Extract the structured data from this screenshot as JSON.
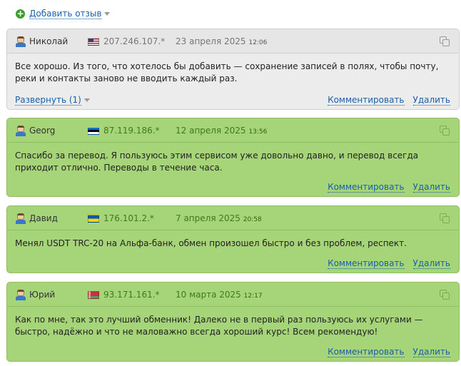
{
  "add_review": {
    "label": "Добавить отзыв"
  },
  "reviews": [
    {
      "name": "Николай",
      "flag": "us-flag-icon",
      "ip": "207.246.107.*",
      "date": "23 апреля 2025",
      "time": "12:06",
      "text": "Все хорошо. Из того, что хотелось бы добавить — сохранение записей в полях, чтобы почту, реки и контакты заново не вводить каждый раз.",
      "expand_label": "Развернуть (1)",
      "comment_label": "Комментировать",
      "delete_label": "Удалить"
    },
    {
      "name": "Georg",
      "flag": "ee-flag-icon",
      "ip": "87.119.186.*",
      "date": "12 апреля 2025",
      "time": "13:56",
      "text": "Спасибо за перевод. Я пользуюсь этим сервисом уже довольно давно, и перевод всегда приходит отлично. Переводы в течение часа.",
      "comment_label": "Комментировать",
      "delete_label": "Удалить"
    },
    {
      "name": "Давид",
      "flag": "ua-flag-icon",
      "ip": "176.101.2.*",
      "date": "7 апреля 2025",
      "time": "20:58",
      "text": "Менял USDT TRC-20 на Альфа-банк, обмен произошел быстро и без проблем, респект.",
      "comment_label": "Комментировать",
      "delete_label": "Удалить"
    },
    {
      "name": "Юрий",
      "flag": "by-flag-icon",
      "ip": "93.171.161.*",
      "date": "10 марта 2025",
      "time": "12:17",
      "text": "Как по мне, так это лучший обменник! Далеко не в первый раз пользуюсь их услугами — быстро, надёжно и что не маловажно всегда хороший курс! Всем рекомендую!",
      "comment_label": "Комментировать",
      "delete_label": "Удалить"
    }
  ],
  "colors": {
    "neutral_card": "#ececec",
    "positive_card": "#a6d479",
    "link": "#1a5fa8",
    "positive_meta": "#3f7a1b"
  }
}
